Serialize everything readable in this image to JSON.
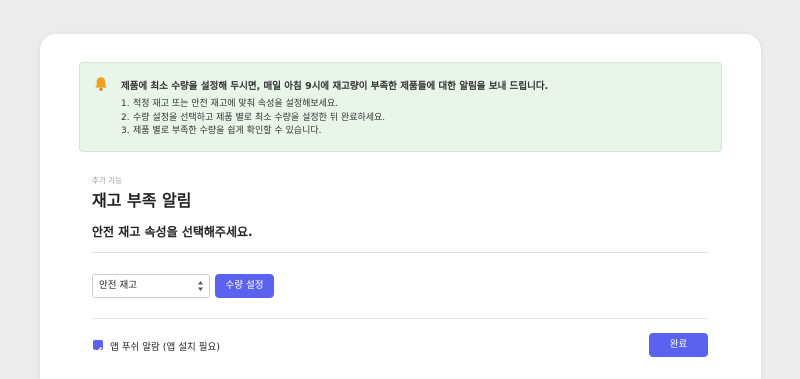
{
  "notice": {
    "icon": "bell-icon",
    "headline": "제품에 최소 수량을 설정해 두시면, 매일 아침 9시에 재고량이 부족한 제품들에 대한 알림을 보내 드립니다.",
    "steps": [
      {
        "num": "1.",
        "text": "적정 재고 또는 안전 재고에 맞춰 속성을 설정해보세요."
      },
      {
        "num": "2.",
        "text": "수량 설정을 선택하고 제품 별로 최소 수량을 설정한 뒤 완료하세요."
      },
      {
        "num": "3.",
        "text": "제품 별로 부족한 수량을 쉽게 확인할 수 있습니다."
      }
    ]
  },
  "section_label": "추가 기능",
  "page_title": "재고 부족 알림",
  "subtitle": "안전 재고 속성을 선택해주세요.",
  "stock_select": {
    "value": "안전 재고"
  },
  "qty_button": "수량 설정",
  "push": {
    "label": "앱 푸쉬 알람 (앱 설치 필요)",
    "checked": true
  },
  "done_button": "완료",
  "colors": {
    "accent": "#5a62ef",
    "notice_bg": "#eaf5ea",
    "bell": "#f0a020"
  }
}
